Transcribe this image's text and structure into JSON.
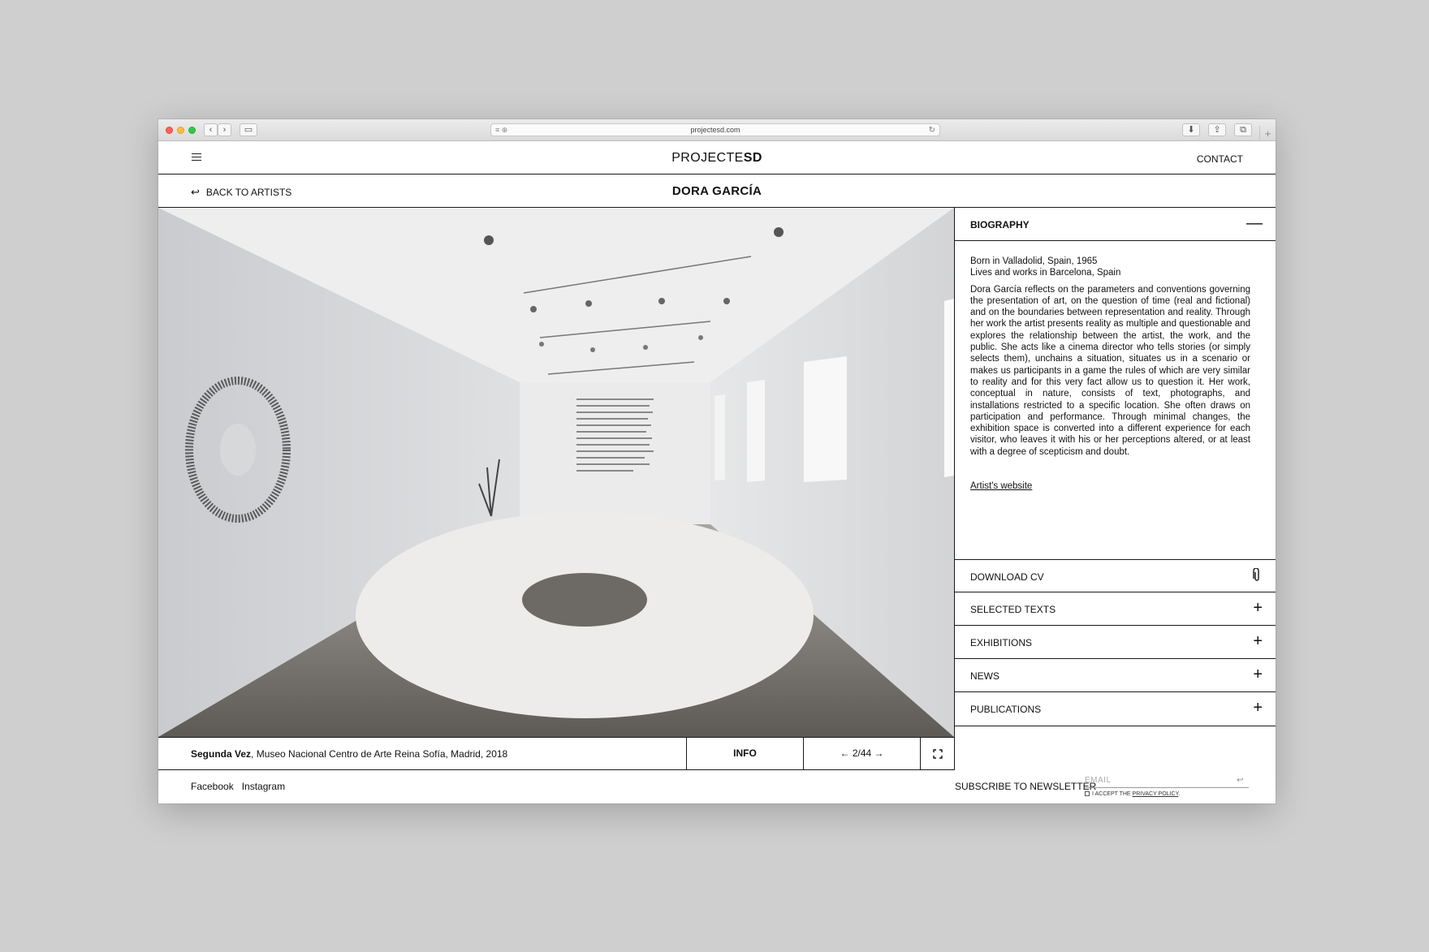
{
  "browser": {
    "url": "projectesd.com"
  },
  "site": {
    "logo_light": "PROJECTE",
    "logo_bold": "SD",
    "contact": "CONTACT",
    "back_label": "BACK TO ARTISTS",
    "artist_name": "DORA GARCÍA"
  },
  "caption": {
    "title": "Segunda Vez",
    "details": ", Museo Nacional Centro de Arte Reina Sofía, Madrid, 2018",
    "info": "INFO",
    "counter": "← 2/44 →"
  },
  "biography": {
    "heading": "BIOGRAPHY",
    "line1": "Born in Valladolid, Spain, 1965",
    "line2": "Lives and works in Barcelona, Spain",
    "text": "Dora García reflects on the parameters and conventions governing the presentation of art, on the question of time (real and fictional) and on the boundaries between representation and reality. Through her work the artist presents reality as multiple and questionable and explores the relationship between the artist, the work, and the public. She acts like a cinema director who tells stories (or simply selects them), unchains a situation, situates us in a scenario or makes us participants in a game the rules of which are very similar to reality and for this very fact allow us to question it. Her work, conceptual in nature, consists of text, photographs, and installations restricted to a specific location. She often draws on participation and performance. Through minimal changes, the exhibition space is converted into a different experience for each visitor, who leaves it with his or her perceptions altered, or at least with a degree of scepticism and doubt.",
    "link": "Artist's website"
  },
  "sections": [
    {
      "label": "DOWNLOAD CV",
      "icon": "paperclip-icon"
    },
    {
      "label": "SELECTED TEXTS",
      "icon": "plus-icon"
    },
    {
      "label": "EXHIBITIONS",
      "icon": "plus-icon"
    },
    {
      "label": "NEWS",
      "icon": "plus-icon"
    },
    {
      "label": "PUBLICATIONS",
      "icon": "plus-icon"
    }
  ],
  "footer": {
    "facebook": "Facebook",
    "instagram": "Instagram",
    "subscribe": "SUBSCRIBE TO NEWSLETTER",
    "email_placeholder": "EMAIL",
    "privacy_prefix": "I ACCEPT THE ",
    "privacy_link": "PRIVACY POLICY",
    "privacy_suffix": "."
  }
}
